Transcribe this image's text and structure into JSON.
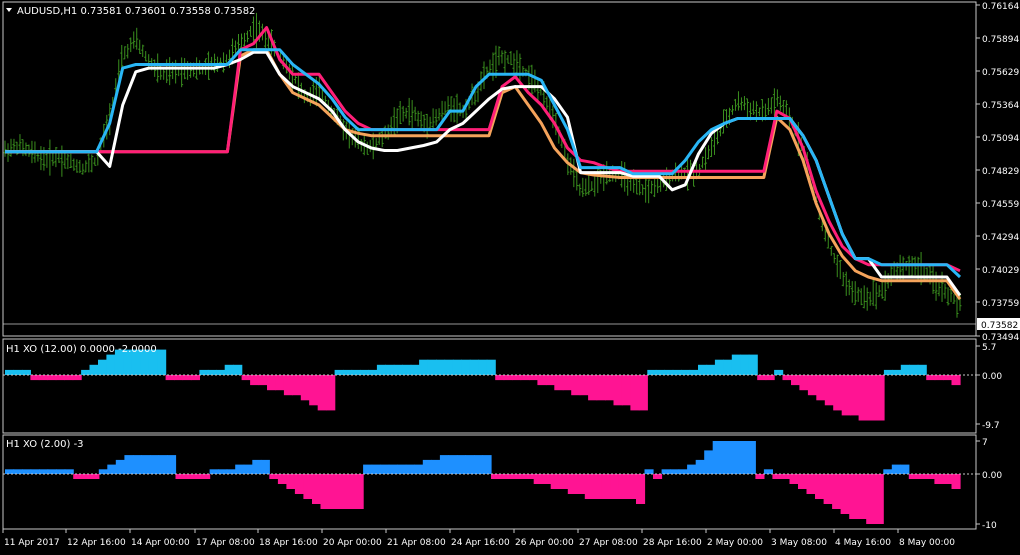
{
  "colors": {
    "background": "#000000",
    "frame": "#c8c8c8",
    "text": "#ffffff",
    "candles": "#3a8f1e",
    "blue_line": "#29b6f6",
    "white_line": "#ffffff",
    "pink_line": "#ff1f78",
    "orange_line": "#f5a35b",
    "hist_pos_1": "#19bff0",
    "hist_neg": "#ff1493",
    "hist_pos_2": "#1e90ff"
  },
  "main": {
    "symbol_label": "AUDUSD,H1  0.73581 0.73601 0.73558 0.73582",
    "menu_icon": "triangle-down-icon",
    "price_ticks": [
      "0.76164",
      "0.75894",
      "0.75629",
      "0.75364",
      "0.75094",
      "0.74829",
      "0.74559",
      "0.74294",
      "0.74029",
      "0.73759",
      "0.73494"
    ],
    "current_price": "0.73582"
  },
  "xo1": {
    "title": "H1 XO (12.00) 0.0000 -2.0000",
    "ticks": [
      "5.7",
      "0.00",
      "-9.7"
    ]
  },
  "xo2": {
    "title": "H1 XO (2.00) -3",
    "ticks": [
      "7",
      "0.00",
      "-10"
    ]
  },
  "time_labels": [
    "11 Apr 2017",
    "12 Apr 16:00",
    "14 Apr 00:00",
    "17 Apr 08:00",
    "18 Apr 16:00",
    "20 Apr 00:00",
    "21 Apr 08:00",
    "24 Apr 16:00",
    "26 Apr 00:00",
    "27 Apr 08:00",
    "28 Apr 16:00",
    "2 May 00:00",
    "3 May 08:00",
    "4 May 16:00",
    "8 May 00:00"
  ],
  "chart_data": [
    {
      "type": "line",
      "title": "AUDUSD,H1",
      "y_ticks": [
        0.76164,
        0.75894,
        0.75629,
        0.75364,
        0.75094,
        0.74829,
        0.74559,
        0.74294,
        0.74029,
        0.73759,
        0.73494
      ],
      "ylim": [
        0.73494,
        0.76164
      ],
      "x_labels": [
        "11 Apr 2017",
        "12 Apr 16:00",
        "14 Apr 00:00",
        "17 Apr 08:00",
        "18 Apr 16:00",
        "20 Apr 00:00",
        "21 Apr 08:00",
        "24 Apr 16:00",
        "26 Apr 00:00",
        "27 Apr 08:00",
        "28 Apr 16:00",
        "2 May 00:00",
        "3 May 08:00",
        "4 May 16:00",
        "8 May 00:00"
      ],
      "price": [
        0.7498,
        0.7502,
        0.7496,
        0.7491,
        0.7493,
        0.7488,
        0.7484,
        0.749,
        0.7525,
        0.7575,
        0.7588,
        0.757,
        0.756,
        0.7562,
        0.7565,
        0.7564,
        0.7568,
        0.7572,
        0.7585,
        0.7598,
        0.759,
        0.7575,
        0.756,
        0.754,
        0.7547,
        0.753,
        0.7515,
        0.7505,
        0.75,
        0.751,
        0.7525,
        0.753,
        0.752,
        0.7525,
        0.7535,
        0.753,
        0.7545,
        0.7565,
        0.7574,
        0.757,
        0.756,
        0.7545,
        0.7525,
        0.749,
        0.7465,
        0.747,
        0.748,
        0.7478,
        0.747,
        0.7465,
        0.747,
        0.7478,
        0.748,
        0.7482,
        0.75,
        0.752,
        0.7538,
        0.7532,
        0.7528,
        0.754,
        0.7524,
        0.75,
        0.7455,
        0.742,
        0.7395,
        0.738,
        0.7378,
        0.7385,
        0.74,
        0.7405,
        0.7402,
        0.739,
        0.7382,
        0.7372
      ],
      "series": [
        {
          "values": [
            0.7497,
            0.7497,
            0.7497,
            0.7497,
            0.7497,
            0.7497,
            0.7497,
            0.7497,
            0.752,
            0.7565,
            0.7568,
            0.7568,
            0.7568,
            0.7568,
            0.7568,
            0.7568,
            0.7568,
            0.7568,
            0.758,
            0.758,
            0.758,
            0.758,
            0.7568,
            0.756,
            0.7552,
            0.754,
            0.7525,
            0.7515,
            0.7515,
            0.7515,
            0.7515,
            0.7515,
            0.7515,
            0.7515,
            0.753,
            0.753,
            0.755,
            0.756,
            0.756,
            0.756,
            0.756,
            0.7555,
            0.7535,
            0.7515,
            0.7484,
            0.7484,
            0.7484,
            0.7484,
            0.7479,
            0.7479,
            0.7479,
            0.7479,
            0.749,
            0.7505,
            0.7515,
            0.752,
            0.7524,
            0.7524,
            0.7524,
            0.7524,
            0.7524,
            0.751,
            0.749,
            0.746,
            0.743,
            0.741,
            0.741,
            0.7405,
            0.7405,
            0.7405,
            0.7405,
            0.7405,
            0.7405,
            0.7395
          ]
        },
        {
          "values": [
            0.7497,
            0.7497,
            0.7497,
            0.7497,
            0.7497,
            0.7497,
            0.7497,
            0.7497,
            0.7485,
            0.7535,
            0.7562,
            0.7565,
            0.7565,
            0.7565,
            0.7565,
            0.7565,
            0.7565,
            0.7568,
            0.7572,
            0.7578,
            0.7578,
            0.756,
            0.755,
            0.7545,
            0.754,
            0.753,
            0.7515,
            0.7505,
            0.75,
            0.7498,
            0.7498,
            0.75,
            0.7502,
            0.7505,
            0.7515,
            0.752,
            0.753,
            0.754,
            0.7548,
            0.755,
            0.755,
            0.755,
            0.754,
            0.7525,
            0.748,
            0.748,
            0.748,
            0.748,
            0.7477,
            0.7477,
            0.7477,
            0.7466,
            0.747,
            0.7495,
            0.7512,
            0.752,
            0.7524,
            0.7524,
            0.7524,
            0.7524,
            0.7524,
            0.751,
            0.749,
            0.746,
            0.743,
            0.741,
            0.741,
            0.7395,
            0.7395,
            0.7395,
            0.7395,
            0.7395,
            0.7395,
            0.738
          ]
        },
        {
          "values": [
            0.7497,
            0.7497,
            0.7497,
            0.7497,
            0.7497,
            0.7497,
            0.7497,
            0.7497,
            0.7497,
            0.7497,
            0.7497,
            0.7497,
            0.7497,
            0.7497,
            0.7497,
            0.7497,
            0.7497,
            0.7497,
            0.758,
            0.7585,
            0.7598,
            0.7572,
            0.756,
            0.756,
            0.756,
            0.7545,
            0.753,
            0.752,
            0.7515,
            0.7515,
            0.7515,
            0.7515,
            0.7515,
            0.7515,
            0.7515,
            0.7515,
            0.7515,
            0.7515,
            0.755,
            0.7558,
            0.7545,
            0.7535,
            0.752,
            0.75,
            0.749,
            0.7488,
            0.7484,
            0.7481,
            0.7481,
            0.7481,
            0.7481,
            0.7481,
            0.7481,
            0.7481,
            0.7481,
            0.7481,
            0.7481,
            0.7481,
            0.7481,
            0.753,
            0.7524,
            0.75,
            0.7465,
            0.744,
            0.742,
            0.741,
            0.7405,
            0.7405,
            0.7405,
            0.7405,
            0.7405,
            0.7405,
            0.7405,
            0.74
          ]
        },
        {
          "values": [
            0.7497,
            0.7497,
            0.7497,
            0.7497,
            0.7497,
            0.7497,
            0.7497,
            0.7497,
            0.7497,
            0.7497,
            0.7497,
            0.7497,
            0.7497,
            0.7497,
            0.7497,
            0.7497,
            0.7497,
            0.7497,
            0.7575,
            0.758,
            0.758,
            0.756,
            0.7545,
            0.754,
            0.7535,
            0.7525,
            0.7515,
            0.7512,
            0.751,
            0.751,
            0.751,
            0.751,
            0.751,
            0.751,
            0.751,
            0.751,
            0.751,
            0.751,
            0.7545,
            0.755,
            0.7535,
            0.752,
            0.75,
            0.7488,
            0.748,
            0.7478,
            0.7477,
            0.7476,
            0.7476,
            0.7476,
            0.7476,
            0.7476,
            0.7476,
            0.7476,
            0.7476,
            0.7476,
            0.7476,
            0.7476,
            0.7476,
            0.7525,
            0.7515,
            0.749,
            0.7455,
            0.743,
            0.7412,
            0.74,
            0.7395,
            0.7392,
            0.7392,
            0.7392,
            0.7392,
            0.7392,
            0.7392,
            0.7377
          ]
        }
      ]
    },
    {
      "type": "bar",
      "title": "H1 XO (12.00) 0.0000 -2.0000",
      "ylim": [
        -9.7,
        5.7
      ],
      "y_ticks": [
        5.7,
        0.0,
        -9.7
      ],
      "values": [
        1,
        1,
        1,
        -1,
        -1,
        -1,
        -1,
        -1,
        -1,
        1,
        2,
        3,
        4,
        5,
        5,
        5,
        5,
        5,
        5,
        -1,
        -1,
        -1,
        -1,
        1,
        1,
        1,
        2,
        2,
        -1,
        -2,
        -2,
        -3,
        -3,
        -4,
        -4,
        -5,
        -6,
        -7,
        -7,
        1,
        1,
        1,
        1,
        1,
        2,
        2,
        2,
        2,
        2,
        3,
        3,
        3,
        3,
        3,
        3,
        3,
        3,
        3,
        -1,
        -1,
        -1,
        -1,
        -1,
        -2,
        -2,
        -3,
        -3,
        -4,
        -4,
        -5,
        -5,
        -5,
        -6,
        -6,
        -7,
        -7,
        1,
        1,
        1,
        1,
        1,
        1,
        2,
        2,
        3,
        3,
        4,
        4,
        4,
        -1,
        -1,
        1,
        -1,
        -2,
        -3,
        -4,
        -5,
        -6,
        -7,
        -8,
        -8,
        -9,
        -9,
        -9,
        1,
        1,
        2,
        2,
        2,
        -1,
        -1,
        -1,
        -2
      ]
    },
    {
      "type": "bar",
      "title": "H1 XO (2.00) -3",
      "ylim": [
        -10,
        7
      ],
      "y_ticks": [
        7,
        0.0,
        -10
      ],
      "values": [
        1,
        1,
        1,
        1,
        1,
        1,
        1,
        1,
        -1,
        -1,
        -1,
        1,
        2,
        3,
        4,
        4,
        4,
        4,
        4,
        4,
        -1,
        -1,
        -1,
        -1,
        1,
        1,
        1,
        2,
        2,
        3,
        3,
        -1,
        -2,
        -3,
        -4,
        -5,
        -6,
        -7,
        -7,
        -7,
        -7,
        -7,
        2,
        2,
        2,
        2,
        2,
        2,
        2,
        3,
        3,
        4,
        4,
        4,
        4,
        4,
        4,
        -1,
        -1,
        -1,
        -1,
        -1,
        -2,
        -2,
        -3,
        -3,
        -4,
        -4,
        -5,
        -5,
        -5,
        -5,
        -5,
        -5,
        -6,
        1,
        -1,
        1,
        1,
        1,
        2,
        3,
        5,
        7,
        7,
        7,
        7,
        7,
        -1,
        1,
        -1,
        -1,
        -2,
        -3,
        -4,
        -5,
        -6,
        -7,
        -8,
        -9,
        -9,
        -10,
        -10,
        1,
        2,
        2,
        -1,
        -1,
        -1,
        -2,
        -2,
        -3
      ]
    }
  ]
}
